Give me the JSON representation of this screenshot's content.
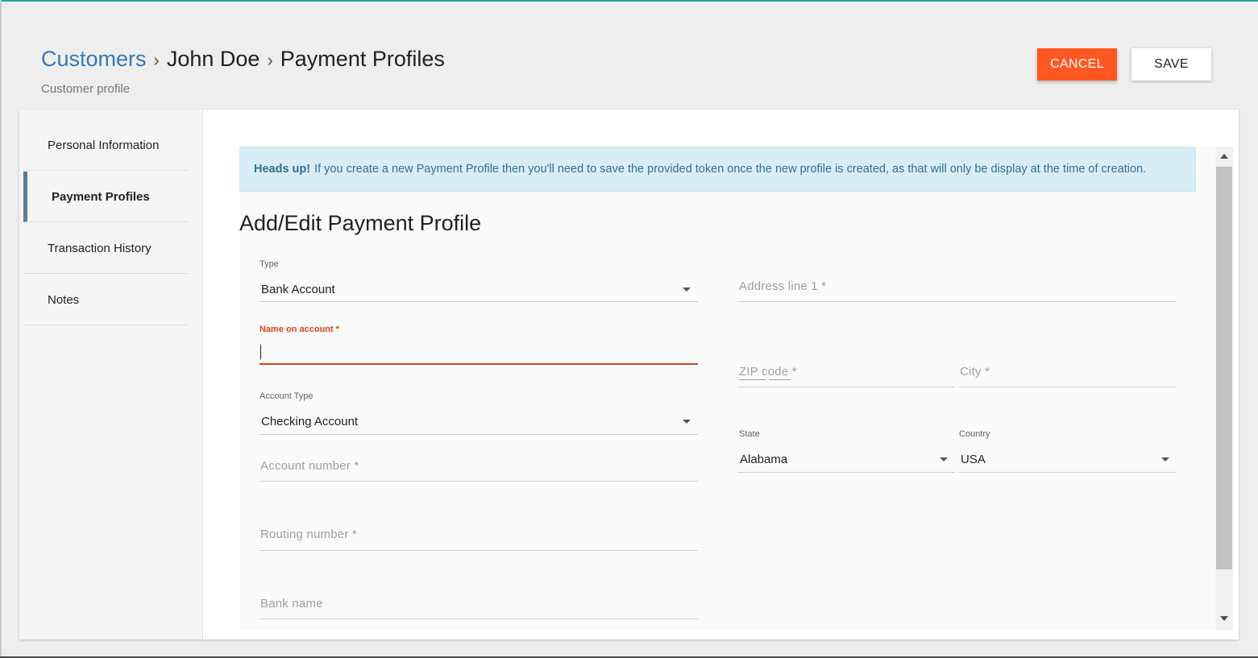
{
  "breadcrumb": {
    "customers": "Customers",
    "customer_name": "John Doe",
    "current": "Payment Profiles",
    "separator": "›"
  },
  "subtitle": "Customer profile",
  "actions": {
    "cancel_label": "CANCEL",
    "save_label": "SAVE"
  },
  "sidebar": {
    "items": [
      {
        "label": "Personal Information",
        "active": false
      },
      {
        "label": "Payment Profiles",
        "active": true
      },
      {
        "label": "Transaction History",
        "active": false
      },
      {
        "label": "Notes",
        "active": false
      }
    ]
  },
  "alert": {
    "strong": "Heads up!",
    "text": "If you create a new Payment Profile then you'll need to save the provided token once the new profile is created, as that will only be display at the time of creation."
  },
  "form": {
    "title": "Add/Edit Payment Profile",
    "type_label": "Type",
    "type_value": "Bank Account",
    "name_label": "Name on account *",
    "name_value": "",
    "account_type_label": "Account Type",
    "account_type_value": "Checking Account",
    "account_number_placeholder": "Account number *",
    "routing_number_placeholder": "Routing number *",
    "bank_name_placeholder": "Bank name",
    "address_line1_placeholder": "Address line 1 *",
    "zip_placeholder": "ZIP code *",
    "city_placeholder": "City *",
    "state_label": "State",
    "state_value": "Alabama",
    "country_label": "Country",
    "country_value": "USA"
  },
  "colors": {
    "accent": "#ff5722",
    "link": "#337ab7",
    "error": "#d84315",
    "alert_bg": "#d9edf7",
    "alert_text": "#31708f",
    "top_bar": "#26a69a"
  }
}
